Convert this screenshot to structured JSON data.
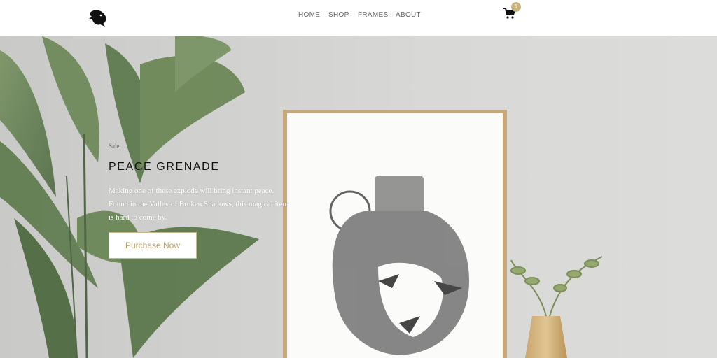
{
  "nav": {
    "items": [
      {
        "label": "HOME"
      },
      {
        "label": "SHOP"
      },
      {
        "label": "FRAMES"
      },
      {
        "label": "ABOUT"
      }
    ],
    "cart_count": "1",
    "icons": {
      "logo": "dolphin-logo-icon",
      "cart": "shopping-cart-icon"
    }
  },
  "hero": {
    "eyebrow": "Sale",
    "title": "PEACE GRENADE",
    "description": "Making one of these explode will bring instant peace. Found in the Valley of Broken Shadows, this magical item is hard to come by.",
    "cta_label": "Purchase Now"
  },
  "colors": {
    "accent": "#c9b47e",
    "cta_border": "#c7b58c",
    "cta_text": "#b9a16c",
    "wall": "#d3d3d1",
    "frame": "#c8a878"
  }
}
